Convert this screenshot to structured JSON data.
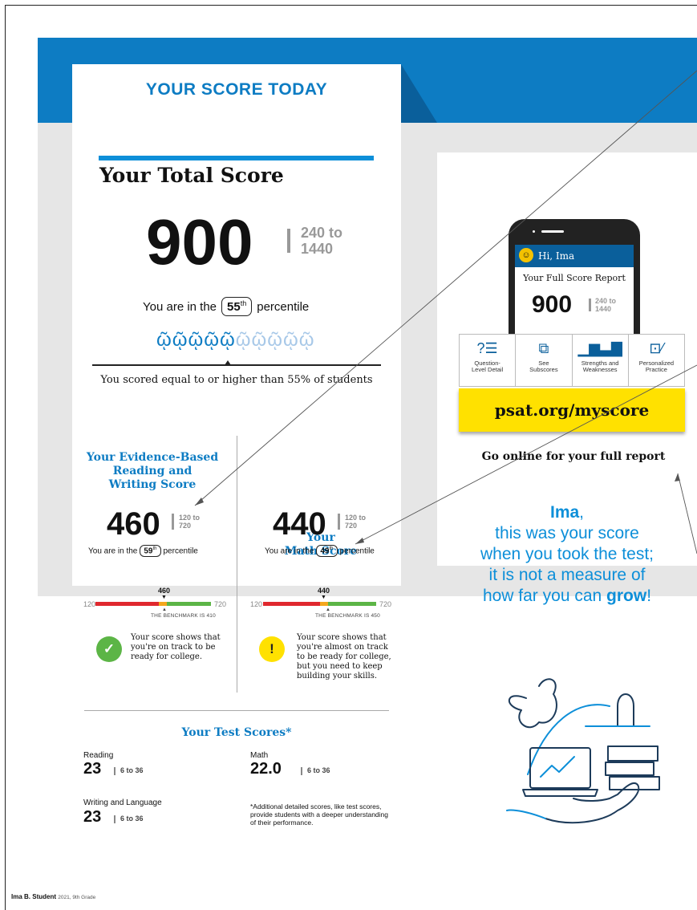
{
  "header": {
    "title": "YOUR SCORE TODAY"
  },
  "total": {
    "title": "Your Total Score",
    "score": "900",
    "range_top": "240 to",
    "range_bottom": "1440",
    "percentile_prefix": "You are in the",
    "percentile": "55",
    "percentile_suffix_sup": "th",
    "percentile_suffix": "percentile",
    "scored_text": "You scored equal to or higher than 55% of students",
    "people_total": 10,
    "people_filled": 5
  },
  "ebrw": {
    "title_lines": [
      "Your Evidence-Based",
      "Reading and",
      "Writing Score"
    ],
    "score": "460",
    "range_top": "120 to",
    "range_bottom": "720",
    "percentile_prefix": "You are in the",
    "percentile": "59",
    "percentile_sup": "th",
    "percentile_suffix": "percentile",
    "marker": "460",
    "min": "120",
    "max": "720",
    "benchmark": "THE BENCHMARK IS 410",
    "status": "on-track",
    "message": [
      "Your score shows that",
      "you're on track to be",
      "ready for college."
    ]
  },
  "math": {
    "title_lines": [
      "Your",
      "Math Score"
    ],
    "score": "440",
    "range_top": "120 to",
    "range_bottom": "720",
    "percentile_prefix": "You are in the",
    "percentile": "49",
    "percentile_sup": "th",
    "percentile_suffix": "percentile",
    "marker": "440",
    "min": "120",
    "max": "720",
    "benchmark": "THE BENCHMARK IS 450",
    "status": "almost",
    "message": [
      "Your score shows that",
      "you're almost on track",
      "to be ready for college,",
      "but you need to keep",
      "building your skills."
    ]
  },
  "test_scores": {
    "title": "Your Test Scores*",
    "reading": {
      "label": "Reading",
      "value": "23",
      "range": "6 to 36"
    },
    "math": {
      "label": "Math",
      "value": "22.0",
      "range": "6 to 36"
    },
    "writing": {
      "label": "Writing and Language",
      "value": "23",
      "range": "6 to 36"
    },
    "footnote": [
      "*Additional detailed scores, like test scores,",
      "provide students with a deeper understanding",
      "of their performance."
    ]
  },
  "phone": {
    "greeting": "Hi, Ima",
    "report_title": "Your Full Score Report",
    "score": "900",
    "range_top": "240 to",
    "range_bottom": "1440"
  },
  "features": [
    {
      "icon": "question-list-icon",
      "label_lines": [
        "Question-",
        "Level Detail"
      ]
    },
    {
      "icon": "hierarchy-icon",
      "label_lines": [
        "See",
        "Subscores"
      ]
    },
    {
      "icon": "bar-chart-icon",
      "label_lines": [
        "Strengths and",
        "Weaknesses"
      ]
    },
    {
      "icon": "practice-icon",
      "label_lines": [
        "Personalized",
        "Practice"
      ]
    }
  ],
  "url": "psat.org/myscore",
  "go_online": "Go online for your full report",
  "message": {
    "name": "Ima",
    "line1_suffix": ",",
    "line2": "this was your score",
    "line3": "when you took the test;",
    "line4": "it is not a measure of",
    "line5_prefix": "how far you can ",
    "line5_bold": "grow",
    "line5_suffix": "!"
  },
  "footer": {
    "name": "Ima B. Student",
    "detail": "2021, 9th Grade"
  },
  "colors": {
    "brand_blue": "#0d7cc3",
    "dark_blue": "#0a5f9b",
    "yellow": "#ffe100",
    "red": "#e0282e",
    "green": "#5cb546",
    "orange": "#f4a71d",
    "check_green": "#5cb546"
  }
}
